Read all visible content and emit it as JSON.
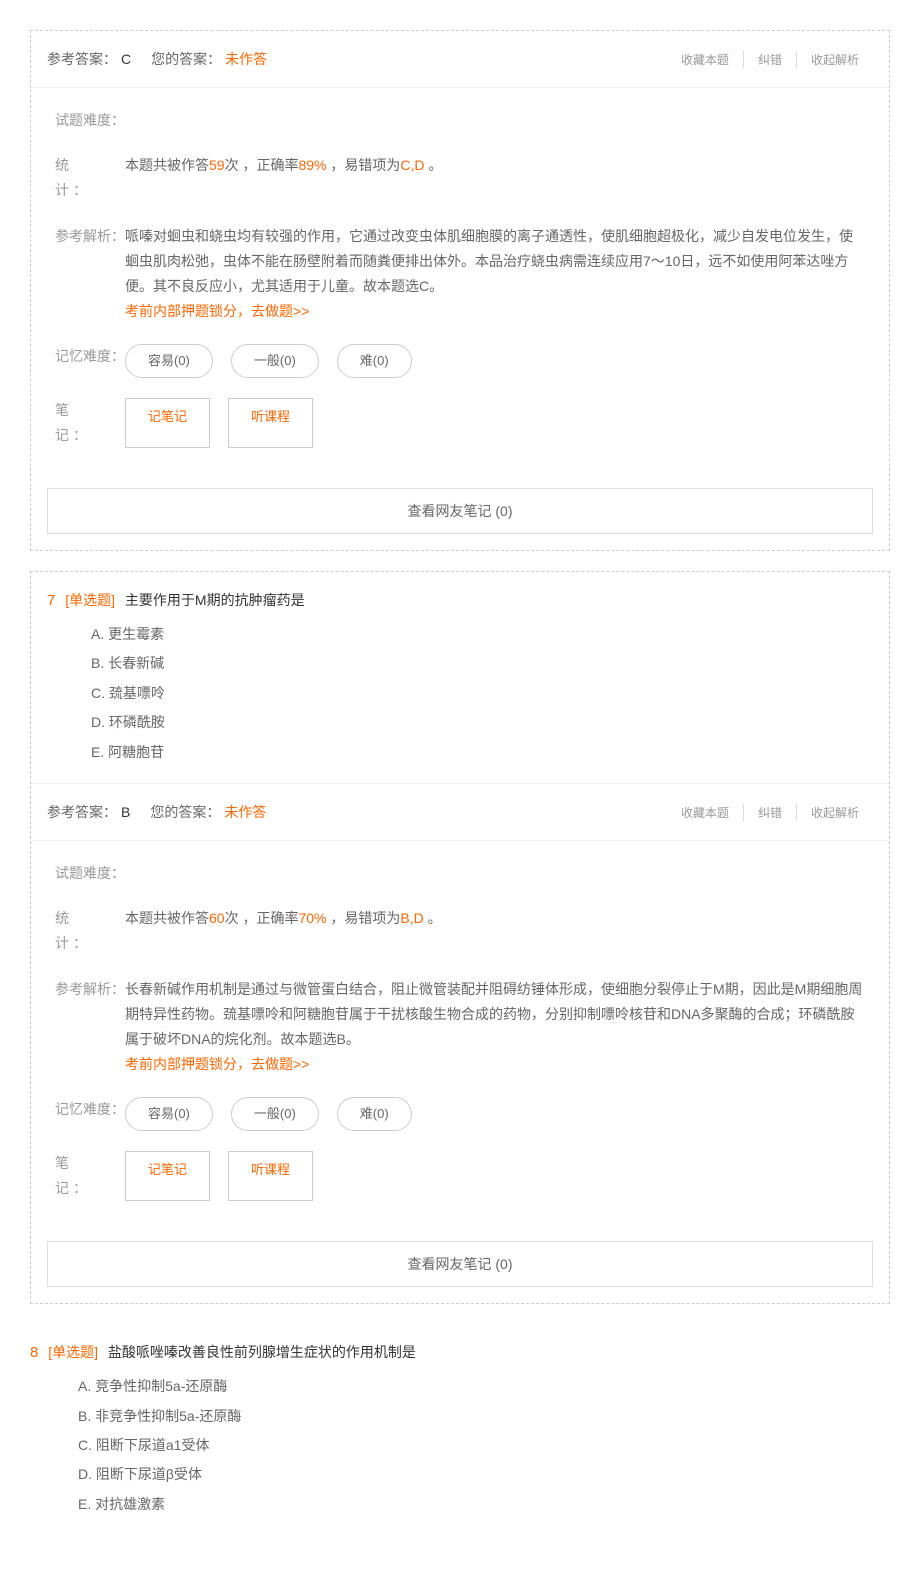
{
  "labels": {
    "ref_answer": "参考答案：",
    "your_answer": "您的答案：",
    "unanswered": "未作答",
    "favorite": "收藏本题",
    "correct_err": "纠错",
    "collapse": "收起解析",
    "difficulty": "试题难度：",
    "stats": "统　　计：",
    "analysis": "参考解析：",
    "memory": "记忆难度：",
    "notes": "笔　　记：",
    "easy": "容易(0)",
    "normal": "一般(0)",
    "hard": "难(0)",
    "take_note": "记笔记",
    "listen": "听课程",
    "pre_exam_link": "考前内部押题锁分，去做题>>",
    "friend_notes": "查看网友笔记 (0)"
  },
  "q6": {
    "answer": "C",
    "stats_pre": "本题共被作答",
    "stats_count": "59",
    "stats_mid": "次 ，正确率",
    "stats_rate": "89%",
    "stats_end1": " ，易错项为",
    "stats_wrong": "C,D",
    "stats_end2": " 。",
    "analysis": "哌嗪对蛔虫和蛲虫均有较强的作用，它通过改变虫体肌细胞膜的离子通透性，使肌细胞超极化，减少自发电位发生，使蛔虫肌肉松弛，虫体不能在肠壁附着而随粪便排出体外。本品治疗蛲虫病需连续应用7～10日，远不如使用阿苯达唑方便。其不良反应小，尤其适用于儿童。故本题选C。"
  },
  "q7": {
    "num": "7",
    "type": "[单选题]",
    "text": "主要作用于M期的抗肿瘤药是",
    "options": {
      "A": "A. 更生霉素",
      "B": "B. 长春新碱",
      "C": "C. 巯基嘌呤",
      "D": "D. 环磷酰胺",
      "E": "E. 阿糖胞苷"
    },
    "answer": "B",
    "stats_pre": "本题共被作答",
    "stats_count": "60",
    "stats_mid": "次 ，正确率",
    "stats_rate": "70%",
    "stats_end1": " ，易错项为",
    "stats_wrong": "B,D",
    "stats_end2": " 。",
    "analysis": "长春新碱作用机制是通过与微管蛋白结合，阻止微管装配并阻碍纺锤体形成，使细胞分裂停止于M期，因此是M期细胞周期特异性药物。巯基嘌呤和阿糖胞苷属于干扰核酸生物合成的药物，分别抑制嘌呤核苷和DNA多聚酶的合成；环磷酰胺属于破坏DNA的烷化剂。故本题选B。"
  },
  "q8": {
    "num": "8",
    "type": "[单选题]",
    "text": "盐酸哌唑嗪改善良性前列腺增生症状的作用机制是",
    "options": {
      "A": "A. 竞争性抑制5a-还原酶",
      "B": "B. 非竞争性抑制5a-还原酶",
      "C": "C. 阻断下尿道a1受体",
      "D": "D. 阻断下尿道β受体",
      "E": "E. 对抗雄激素"
    }
  }
}
